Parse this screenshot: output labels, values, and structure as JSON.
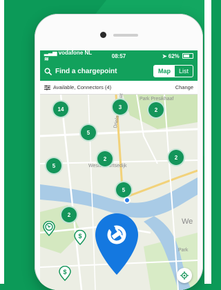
{
  "status_bar": {
    "carrier": "vodafone NL",
    "time": "08:57",
    "battery": "62%"
  },
  "app_bar": {
    "search_label": "Find a chargepoint",
    "view_toggle": {
      "options": [
        "Map",
        "List"
      ],
      "selected": "Map"
    }
  },
  "filter_bar": {
    "text": "Available, Connectors (4)",
    "action": "Change"
  },
  "map": {
    "place_labels": [
      "Park Presikhaaf",
      "Westervoortsedijk",
      "Drielandsestraat",
      "We",
      "Park"
    ],
    "clusters": [
      {
        "count": "14"
      },
      {
        "count": "3"
      },
      {
        "count": "2"
      },
      {
        "count": "5"
      },
      {
        "count": "5"
      },
      {
        "count": "2"
      },
      {
        "count": "2"
      },
      {
        "count": "5"
      },
      {
        "count": "2"
      }
    ]
  },
  "colors": {
    "brand_green": "#12a15c",
    "cluster_green": "#14955a",
    "marker_blue": "#1478e0",
    "location_blue": "#2b7de9",
    "background_green": "#0c9a58"
  }
}
